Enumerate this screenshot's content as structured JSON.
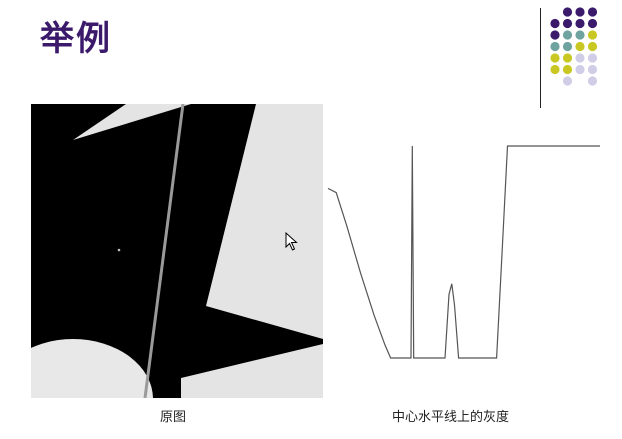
{
  "slide": {
    "title": "举例"
  },
  "decoration": {
    "dot_colors": {
      "purple": "#3b1a6b",
      "teal": "#6fa3a0",
      "olive": "#c9c823",
      "lavender": "#d0cde6"
    }
  },
  "figures": {
    "left_caption": "原图",
    "right_caption": "中心水平线上的灰度"
  },
  "icons": {
    "cursor": "mouse-pointer-icon"
  },
  "chart_data": {
    "type": "line",
    "title": "",
    "xlabel": "",
    "ylabel": "",
    "x": [
      0,
      0.03,
      0.07,
      0.12,
      0.17,
      0.21,
      0.23,
      0.27,
      0.305,
      0.31,
      0.315,
      0.32,
      0.33,
      0.4,
      0.43,
      0.445,
      0.455,
      0.465,
      0.48,
      0.56,
      0.62,
      0.64,
      0.66,
      0.7,
      1.0
    ],
    "values": [
      0.8,
      0.78,
      0.62,
      0.4,
      0.2,
      0.06,
      0.0,
      0.0,
      0.0,
      1.0,
      0.0,
      0.0,
      0.0,
      0.0,
      0.0,
      0.3,
      0.35,
      0.25,
      0.0,
      0.0,
      0.0,
      0.5,
      1.0,
      1.0,
      1.0
    ],
    "xlim": [
      0,
      1
    ],
    "ylim": [
      0,
      1
    ],
    "grid": false,
    "line_color": "#555555"
  }
}
